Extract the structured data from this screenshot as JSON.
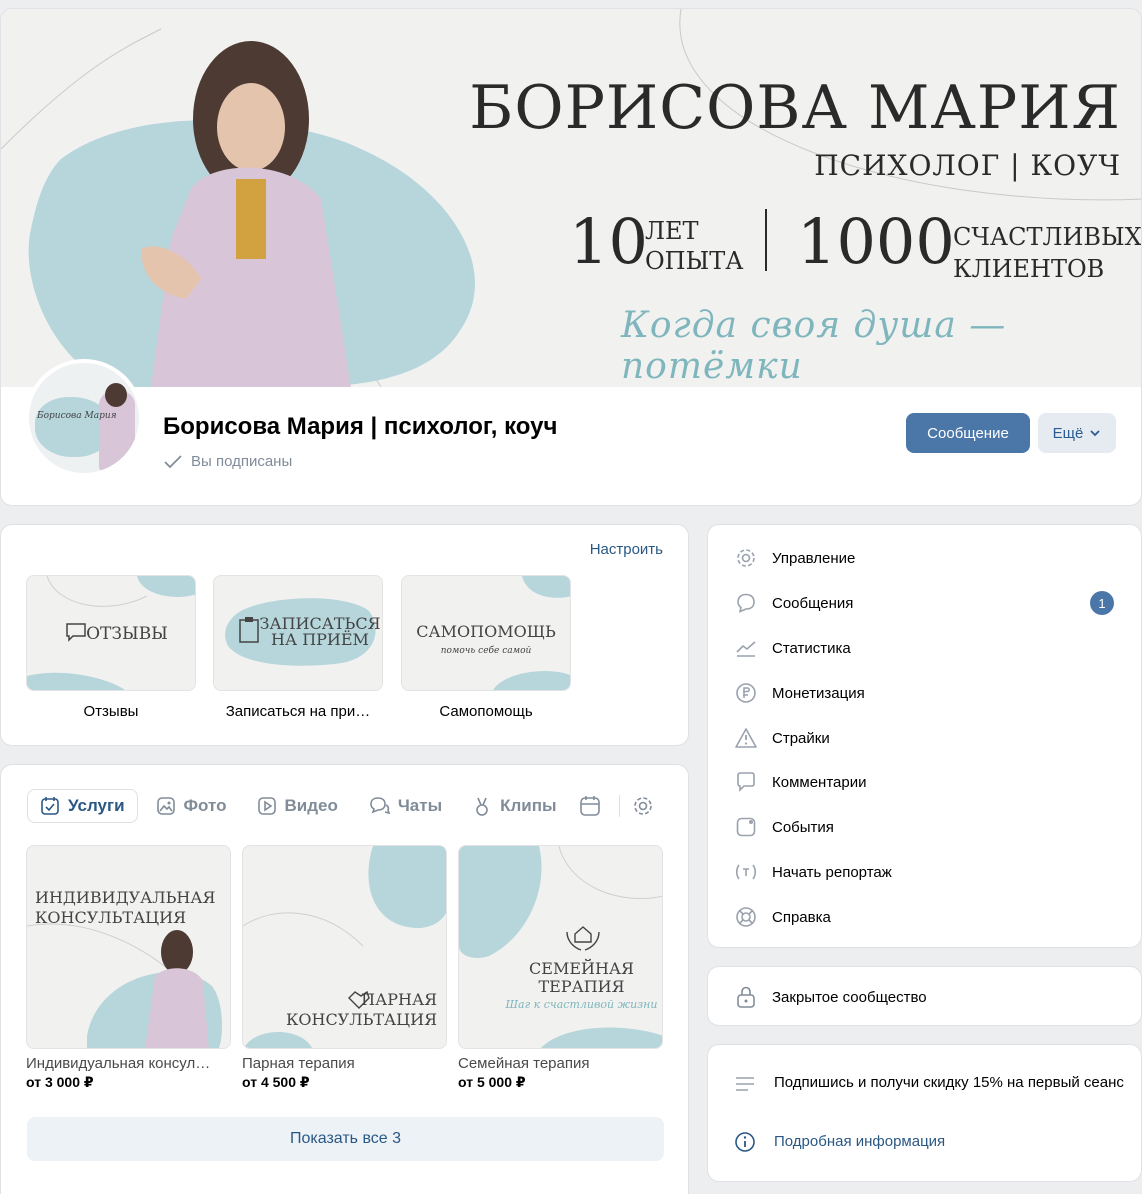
{
  "cover": {
    "name": "БОРИСОВА МАРИЯ",
    "subtitle": "ПСИХОЛОГ | КОУЧ",
    "stat1_num": "10",
    "stat1_line1": "ЛЕТ",
    "stat1_line2": "ОПЫТА",
    "stat2_num": "1000",
    "stat2_line1": "СЧАСТЛИВЫХ",
    "stat2_line2": "КЛИЕНТОВ",
    "quote": "Когда своя душа — потёмки"
  },
  "header": {
    "avatar_text": "Борисова Мария",
    "title": "Борисова Мария | психолог, коуч",
    "subscribed": "Вы подписаны",
    "message_button": "Сообщение",
    "more_button": "Ещё"
  },
  "apps": {
    "configure": "Настроить",
    "items": [
      {
        "label": "Отзывы",
        "thumb": "ОТЗЫВЫ"
      },
      {
        "label": "Записаться на при…",
        "thumb_line1": "ЗАПИСАТЬСЯ",
        "thumb_line2": "НА ПРИЁМ"
      },
      {
        "label": "Самопомощь",
        "thumb": "САМОПОМОЩЬ",
        "thumb_sub": "помочь себе самой"
      }
    ]
  },
  "tabs": [
    {
      "label": "Услуги",
      "icon": "calendar-check-icon"
    },
    {
      "label": "Фото",
      "icon": "image-icon"
    },
    {
      "label": "Видео",
      "icon": "play-icon"
    },
    {
      "label": "Чаты",
      "icon": "chats-icon"
    },
    {
      "label": "Клипы",
      "icon": "clips-icon"
    }
  ],
  "services": {
    "items": [
      {
        "name": "Индивидуальная консул…",
        "price": "от 3 000 ₽",
        "thumb_line1": "ИНДИВИДУАЛЬНАЯ",
        "thumb_line2": "КОНСУЛЬТАЦИЯ"
      },
      {
        "name": "Парная терапия",
        "price": "от 4 500 ₽",
        "thumb_line1": "ПАРНАЯ",
        "thumb_line2": "КОНСУЛЬТАЦИЯ"
      },
      {
        "name": "Семейная терапия",
        "price": "от 5 000 ₽",
        "thumb_line1": "СЕМЕЙНАЯ",
        "thumb_line2": "ТЕРАПИЯ",
        "thumb_sub": "Шаг к счастливой жизни"
      }
    ],
    "show_all": "Показать все 3"
  },
  "menu": {
    "items": [
      {
        "label": "Управление",
        "icon": "gear-icon"
      },
      {
        "label": "Сообщения",
        "icon": "message-icon",
        "badge": "1"
      },
      {
        "label": "Статистика",
        "icon": "stats-icon"
      },
      {
        "label": "Монетизация",
        "icon": "ruble-icon"
      },
      {
        "label": "Страйки",
        "icon": "warning-icon"
      },
      {
        "label": "Комментарии",
        "icon": "comment-icon"
      },
      {
        "label": "События",
        "icon": "event-icon"
      },
      {
        "label": "Начать репортаж",
        "icon": "broadcast-icon"
      },
      {
        "label": "Справка",
        "icon": "help-icon"
      }
    ]
  },
  "closed": {
    "label": "Закрытое сообщество"
  },
  "promo": {
    "text": "Подпишись и получи скидку 15% на первый сеанс",
    "link": "Подробная информация"
  },
  "colors": {
    "accent": "#4a76a8",
    "link": "#2a5885",
    "cover_blob": "#b6d6db",
    "quote": "#7fb6bd"
  }
}
